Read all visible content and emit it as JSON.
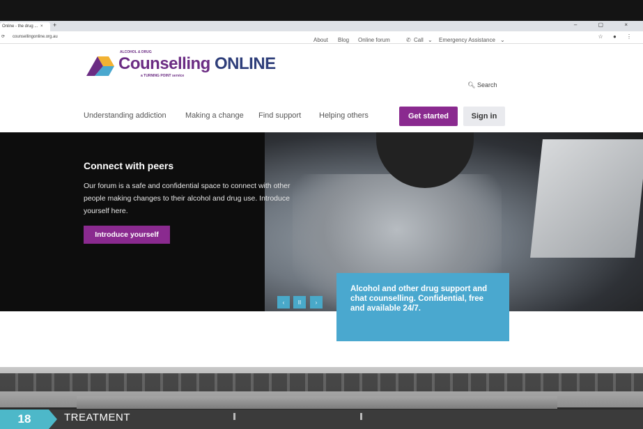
{
  "browser": {
    "tab_title": "Online - the drug ...",
    "tab_close": "×",
    "new_tab": "+",
    "window_controls": "– ▢ ×",
    "address": "counsellingonline.org.au",
    "address_right": "☆ ● ⋮"
  },
  "utility_nav": {
    "about": "About",
    "blog": "Blog",
    "forum": "Online forum",
    "call": "Call",
    "emergency": "Emergency Assistance"
  },
  "logo": {
    "top_text": "ALCOHOL & DRUG",
    "main_word": "Counselling",
    "online_word": "ONLINE",
    "sub_text": "a TURNING POINT service"
  },
  "search_label": "Search",
  "main_nav": {
    "item1": "Understanding addiction",
    "item2": "Making a change",
    "item3": "Find support",
    "item4": "Helping others",
    "get_started": "Get started",
    "sign_in": "Sign in"
  },
  "hero": {
    "title": "Connect with peers",
    "body": "Our forum is a safe and confidential space to connect with other people making changes to their alcohol and drug use. Introduce yourself here.",
    "button": "Introduce yourself",
    "prev": "‹",
    "pause": "II",
    "next": "›"
  },
  "callout": "Alcohol and other drug support and chat counselling. Confidential, free and available 24/7.",
  "footer": {
    "page_number": "18",
    "section": "TREATMENT"
  },
  "colors": {
    "brand_purple": "#8a2a8f",
    "brand_blue": "#4aa8cf",
    "page_tag": "#4db8c9"
  }
}
